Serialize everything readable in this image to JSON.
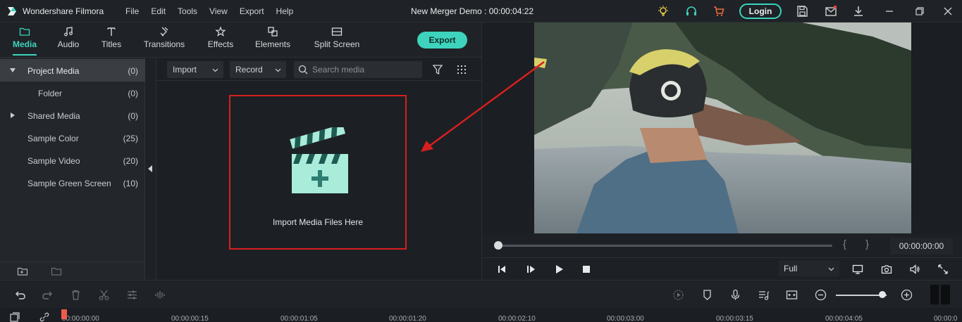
{
  "app": {
    "name": "Wondershare Filmora",
    "doc_title": "New Merger Demo : 00:00:04:22",
    "login_label": "Login"
  },
  "menu": [
    "File",
    "Edit",
    "Tools",
    "View",
    "Export",
    "Help"
  ],
  "tabs": [
    {
      "label": "Media",
      "icon": "folder-icon"
    },
    {
      "label": "Audio",
      "icon": "music-note-icon"
    },
    {
      "label": "Titles",
      "icon": "text-icon"
    },
    {
      "label": "Transitions",
      "icon": "transition-icon"
    },
    {
      "label": "Effects",
      "icon": "effects-icon"
    },
    {
      "label": "Elements",
      "icon": "elements-icon"
    },
    {
      "label": "Split Screen",
      "icon": "split-screen-icon"
    }
  ],
  "export_label": "Export",
  "library": [
    {
      "name": "Project Media",
      "count": "(0)"
    },
    {
      "name": "Folder",
      "count": "(0)"
    },
    {
      "name": "Shared Media",
      "count": "(0)"
    },
    {
      "name": "Sample Color",
      "count": "(25)"
    },
    {
      "name": "Sample Video",
      "count": "(20)"
    },
    {
      "name": "Sample Green Screen",
      "count": "(10)"
    }
  ],
  "media_toolbar": {
    "import_label": "Import",
    "record_label": "Record",
    "search_placeholder": "Search media"
  },
  "import_area": {
    "text": "Import Media Files Here"
  },
  "preview": {
    "braces_open": "{",
    "braces_close": "}",
    "timecode": "00:00:00:00",
    "fit_label": "Full",
    "progress": 0
  },
  "timeline": {
    "ruler": [
      "00:00:00:00",
      "00:00:00:15",
      "00:00:01:05",
      "00:00:01:20",
      "00:00:02:10",
      "00:00:03:00",
      "00:00:03:15",
      "00:00:04:05",
      "00:00:0"
    ]
  },
  "colors": {
    "accent": "#3ed3bd",
    "highlight_box": "#d71f1f",
    "playhead": "#ef5b4b"
  }
}
